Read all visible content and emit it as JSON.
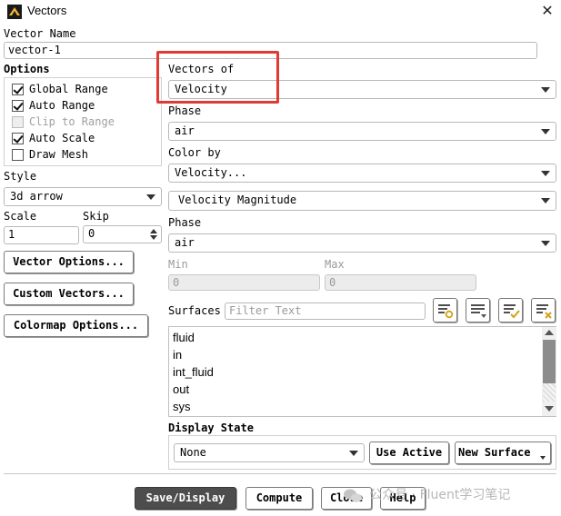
{
  "window": {
    "title": "Vectors"
  },
  "vector_name": {
    "label": "Vector Name",
    "value": "vector-1"
  },
  "options": {
    "label": "Options",
    "items": [
      {
        "label": "Global Range",
        "checked": true,
        "enabled": true
      },
      {
        "label": "Auto Range",
        "checked": true,
        "enabled": true
      },
      {
        "label": "Clip to Range",
        "checked": false,
        "enabled": false
      },
      {
        "label": "Auto Scale",
        "checked": true,
        "enabled": true
      },
      {
        "label": "Draw Mesh",
        "checked": false,
        "enabled": true
      }
    ]
  },
  "style": {
    "label": "Style",
    "value": "3d arrow"
  },
  "scale": {
    "label": "Scale",
    "value": "1"
  },
  "skip": {
    "label": "Skip",
    "value": "0"
  },
  "left_buttons": {
    "vector_options": "Vector Options...",
    "custom_vectors": "Custom Vectors...",
    "colormap_options": "Colormap Options..."
  },
  "vectors_of": {
    "label": "Vectors of",
    "value": "Velocity"
  },
  "phase1": {
    "label": "Phase",
    "value": "air"
  },
  "color_by": {
    "label": "Color by",
    "value": "Velocity...",
    "sub_value": "Velocity Magnitude"
  },
  "phase2": {
    "label": "Phase",
    "value": "air"
  },
  "min": {
    "label": "Min",
    "value": "0"
  },
  "max": {
    "label": "Max",
    "value": "0"
  },
  "surfaces": {
    "label": "Surfaces",
    "filter_placeholder": "Filter Text",
    "items": [
      "fluid",
      "in",
      "int_fluid",
      "out",
      "sys"
    ]
  },
  "display_state": {
    "label": "Display State",
    "value": "None",
    "use_active": "Use Active",
    "new_surface": "New Surface"
  },
  "footer": {
    "save_display": "Save/Display",
    "compute": "Compute",
    "close": "Close",
    "help": "Help"
  },
  "watermark": "公众号 · Fluent学习笔记",
  "colors": {
    "highlight": "#e03b32",
    "primary_button": "#4d4d4d",
    "scroll_thumb": "#8c8c8c"
  }
}
